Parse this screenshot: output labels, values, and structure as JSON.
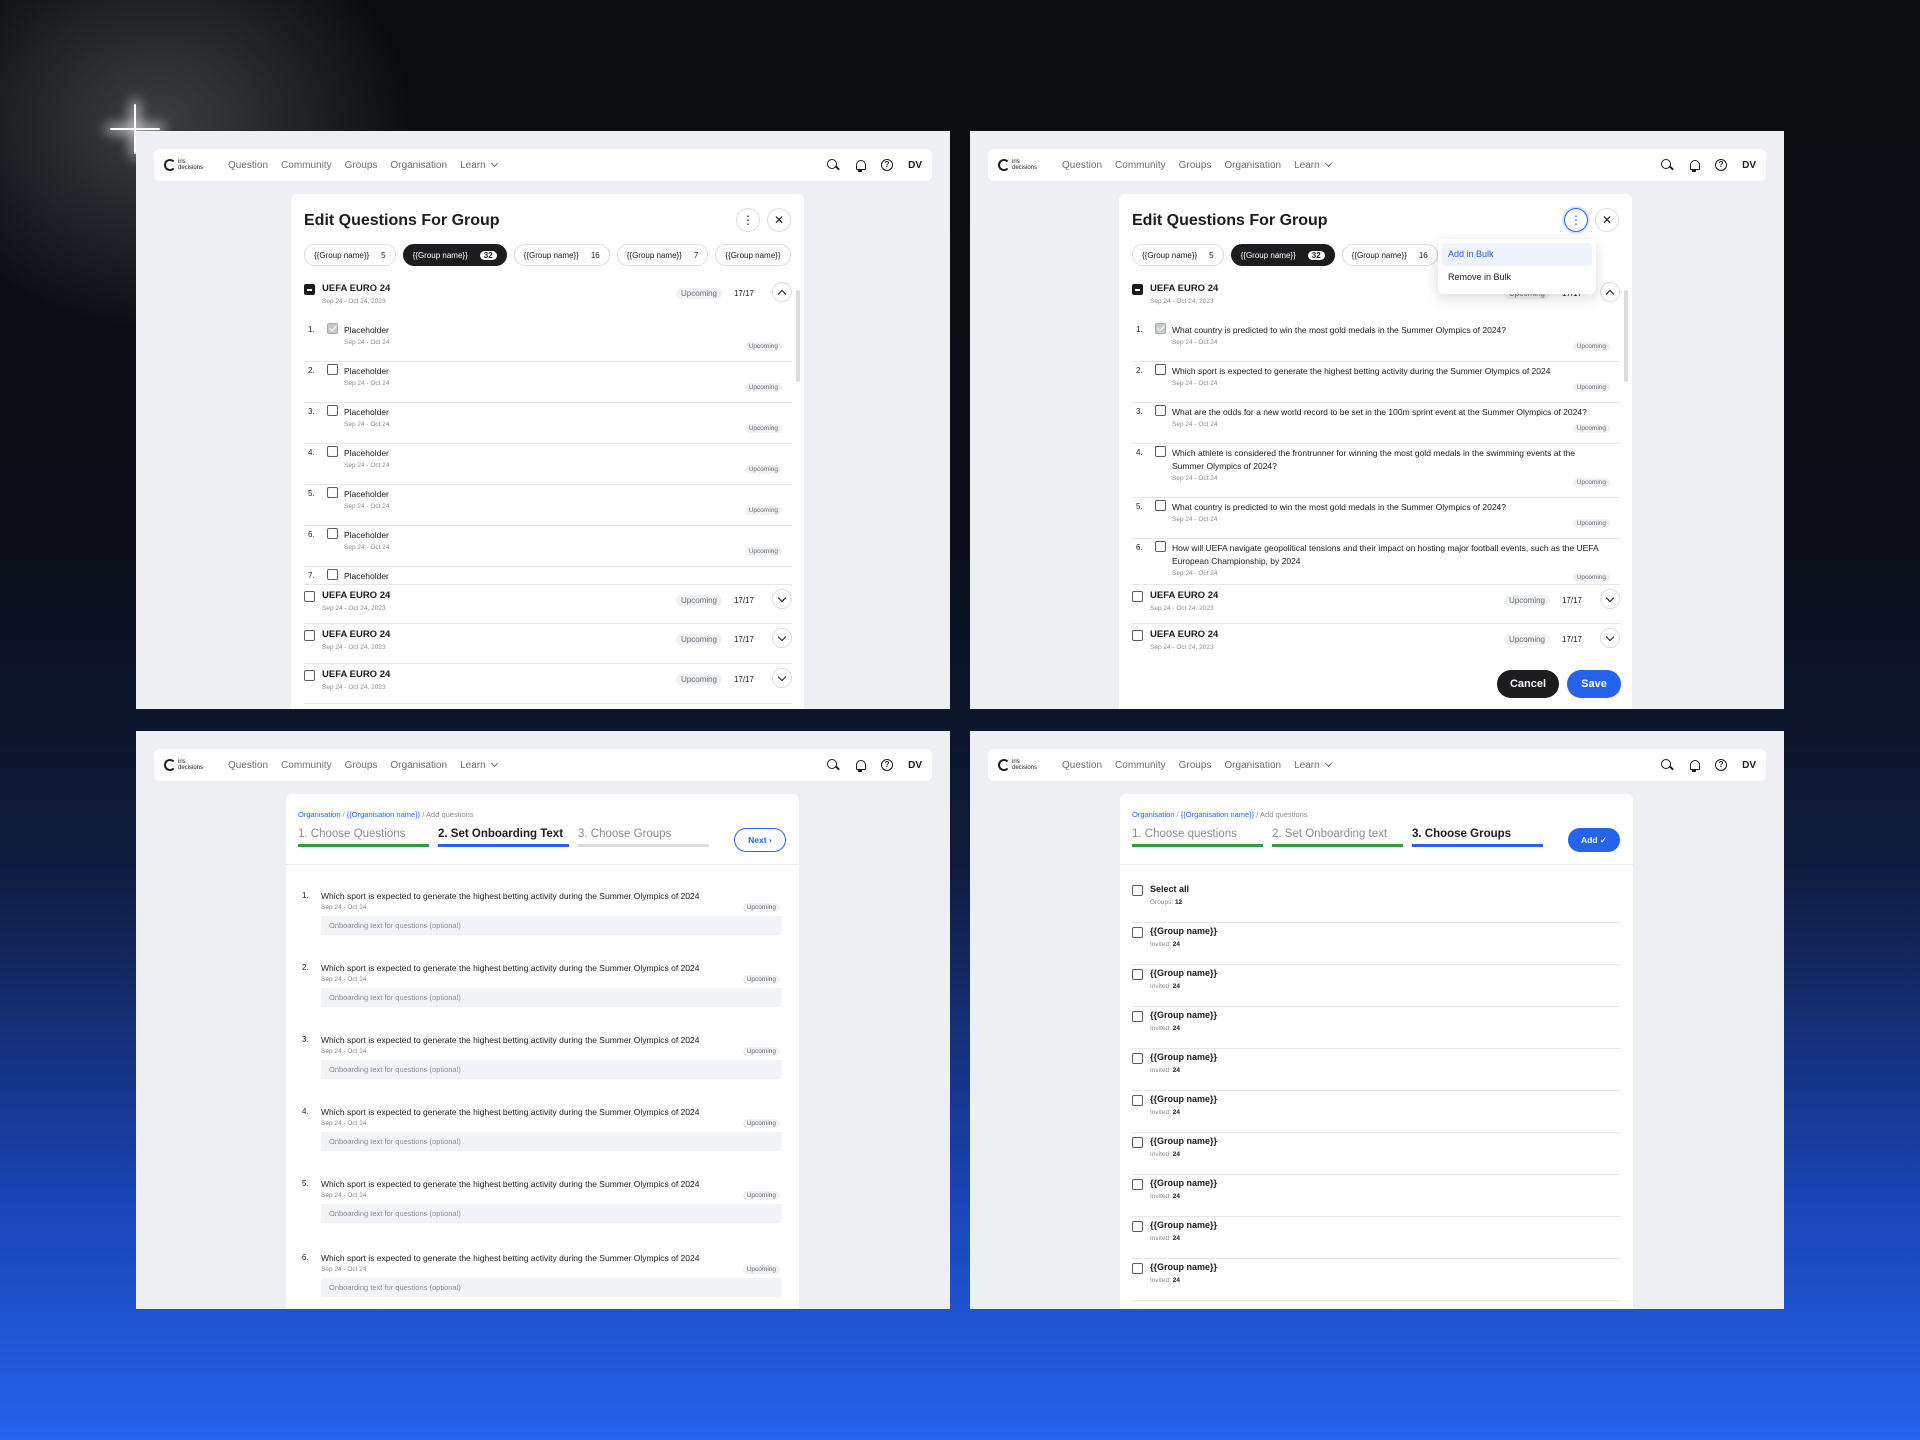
{
  "nav": {
    "items": [
      "Question",
      "Community",
      "Groups",
      "Organisation",
      "Learn"
    ],
    "logo_text": "iris decisions",
    "avatar": "DV"
  },
  "edit": {
    "title": "Edit Questions For Group",
    "tabs": [
      {
        "label": "{{Group name}}",
        "count": "5"
      },
      {
        "label": "{{Group name}}",
        "count": "32"
      },
      {
        "label": "{{Group name}}",
        "count": "16"
      },
      {
        "label": "{{Group name}}",
        "count": "7"
      },
      {
        "label": "{{Group name}}",
        "count": ""
      }
    ],
    "group_title": "UEFA EURO 24",
    "group_date": "Sep 24 - Oct 24, 2023",
    "status": "Upcoming",
    "count": "17/17",
    "placeholder": "Placeholder",
    "q_date": "Sep 24 - Oct 24",
    "questions": [
      "What country is predicted to win the most gold medals in the Summer Olympics of 2024?",
      "Which sport is expected to generate the highest betting activity during the Summer Olympics of 2024",
      "What are the odds for a new world record to be set in the 100m sprint event at the Summer Olympics of 2024?",
      "Which athlete is considered the frontrunner for winning the most gold medals in the swimming events at the Summer Olympics of 2024?",
      "What country is predicted to win the most gold medals in the Summer Olympics of 2024?",
      "How will UEFA navigate geopolitical tensions and their impact on hosting major football events, such as the UEFA European Championship, by 2024"
    ],
    "menu": [
      "Add in Bulk",
      "Remove in Bulk"
    ],
    "cancel": "Cancel",
    "save": "Save"
  },
  "onboard": {
    "bc_org": "Organisation",
    "bc_sep": " / ",
    "bc_name": "{{Organisation name}}",
    "bc_cur": " / Add questions",
    "steps": [
      "1. Choose Questions",
      "2. Set Onboarding Text",
      "3. Choose Groups"
    ],
    "next": "Next",
    "question": "Which sport is expected to generate the highest betting activity during the Summer Olympics of 2024",
    "input_placeholder": "Onboarding text for questions (optional)"
  },
  "choose": {
    "steps": [
      "1. Choose questions",
      "2. Set Onboarding text",
      "3. Choose Groups"
    ],
    "add": "Add",
    "select_all": "Select all",
    "groups_label": "Groups:",
    "groups_count": "12",
    "group": "{{Group name}}",
    "invited_label": "Invited:",
    "invited_count": "24"
  }
}
